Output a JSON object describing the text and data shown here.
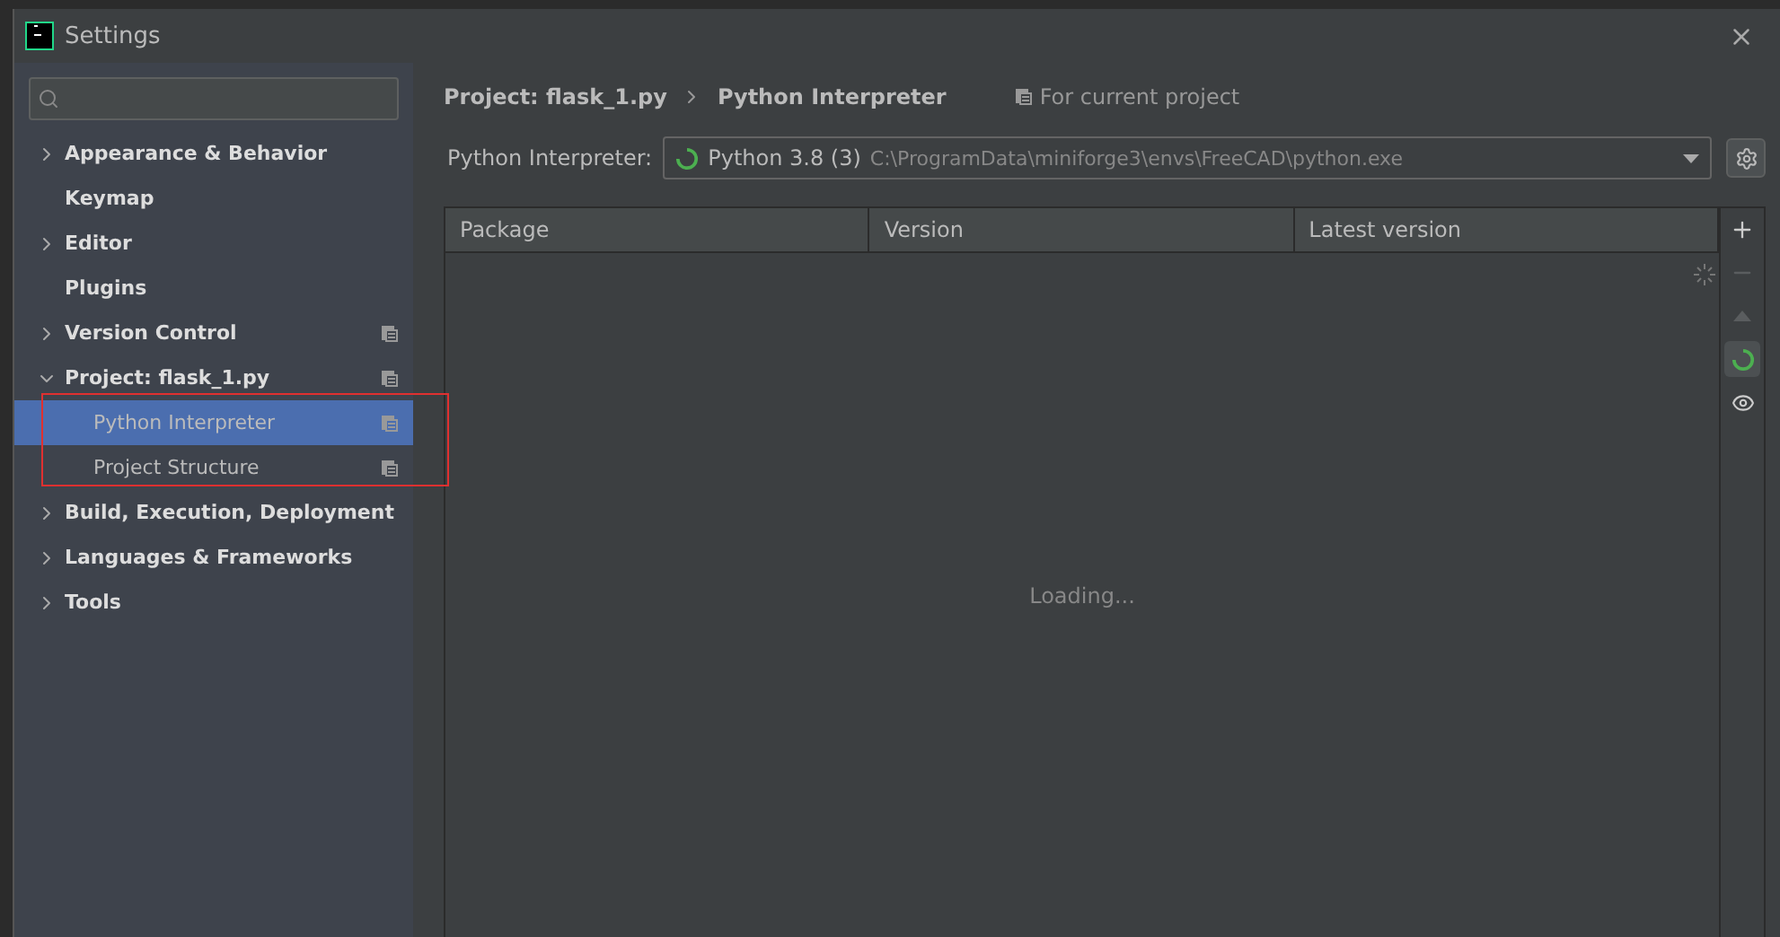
{
  "window": {
    "title": "Settings"
  },
  "tree": [
    {
      "label": "Appearance & Behavior",
      "expandable": true,
      "expanded": false,
      "project_scoped": false,
      "selected": false
    },
    {
      "label": "Keymap",
      "expandable": false,
      "project_scoped": false,
      "selected": false
    },
    {
      "label": "Editor",
      "expandable": true,
      "expanded": false,
      "project_scoped": false,
      "selected": false
    },
    {
      "label": "Plugins",
      "expandable": false,
      "project_scoped": false,
      "selected": false
    },
    {
      "label": "Version Control",
      "expandable": true,
      "expanded": false,
      "project_scoped": true,
      "selected": false
    },
    {
      "label": "Project: flask_1.py",
      "expandable": true,
      "expanded": true,
      "project_scoped": true,
      "selected": false,
      "children": [
        {
          "label": "Python Interpreter",
          "project_scoped": true,
          "selected": true
        },
        {
          "label": "Project Structure",
          "project_scoped": true,
          "selected": false
        }
      ]
    },
    {
      "label": "Build, Execution, Deployment",
      "expandable": true,
      "expanded": false,
      "project_scoped": false,
      "selected": false
    },
    {
      "label": "Languages & Frameworks",
      "expandable": true,
      "expanded": false,
      "project_scoped": false,
      "selected": false
    },
    {
      "label": "Tools",
      "expandable": true,
      "expanded": false,
      "project_scoped": false,
      "selected": false
    }
  ],
  "breadcrumb": [
    "Project: flask_1.py",
    "Python Interpreter"
  ],
  "scope_note": "For current project",
  "interpreter": {
    "label": "Python Interpreter:",
    "name": "Python 3.8 (3)",
    "path": "C:\\ProgramData\\miniforge3\\envs\\FreeCAD\\python.exe"
  },
  "table": {
    "columns": [
      "Package",
      "Version",
      "Latest version"
    ],
    "status": "Loading..."
  },
  "side_tools": [
    {
      "kind": "add",
      "disabled": false
    },
    {
      "kind": "remove",
      "disabled": true
    },
    {
      "kind": "upgrade",
      "disabled": true
    },
    {
      "kind": "conda",
      "disabled": false
    },
    {
      "kind": "show",
      "disabled": false
    }
  ]
}
